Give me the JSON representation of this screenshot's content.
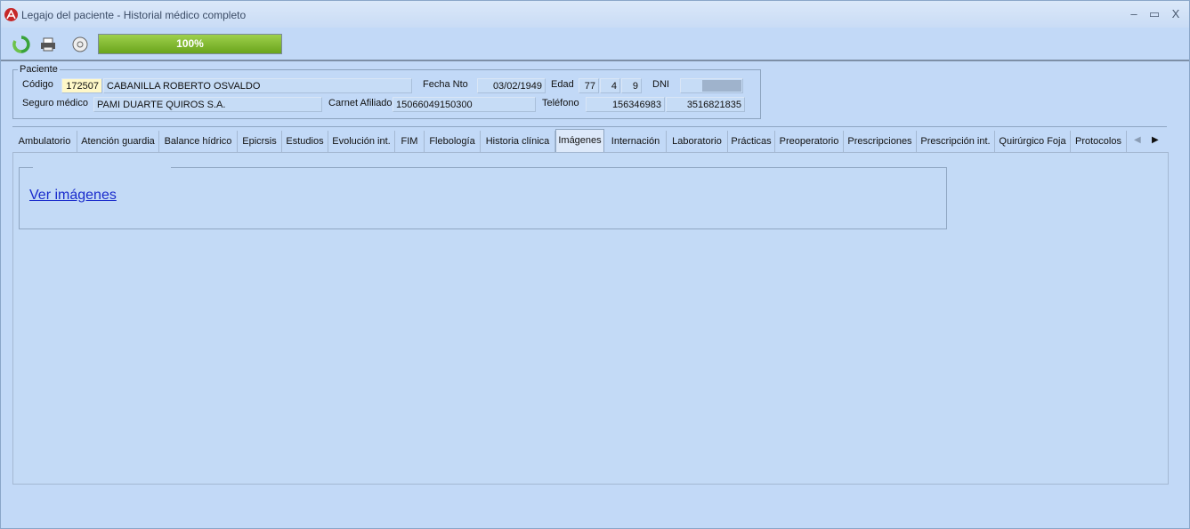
{
  "window": {
    "title": "Legajo del paciente - Historial médico completo",
    "controls": {
      "minimize": "–",
      "maximize": "▭",
      "close": "X"
    }
  },
  "toolbar": {
    "icons": [
      "refresh-icon",
      "printer-icon",
      "options-icon"
    ],
    "progress": {
      "value": 1.0,
      "label": "100%"
    }
  },
  "patient": {
    "legend": "Paciente",
    "codigo_label": "Código",
    "codigo_value": "172507",
    "nombre_value": "CABANILLA ROBERTO OSVALDO",
    "fecha_nto_label": "Fecha Nto",
    "fecha_nto_value": "03/02/1949",
    "edad_label": "Edad",
    "edad_years": "77",
    "edad_months": "4",
    "edad_days": "9",
    "dni_label": "DNI",
    "dni_value": "",
    "seguro_label": "Seguro médico",
    "seguro_value": "PAMI DUARTE QUIROS S.A.",
    "carnet_label": "Carnet Afiliado",
    "carnet_value": "15066049150300",
    "telefono_label": "Teléfono",
    "telefono1": "156346983",
    "telefono2": "3516821835"
  },
  "tabs": [
    "Ambulatorio",
    "Atención guardia",
    "Balance hídrico",
    "Epicrsis",
    "Estudios",
    "Evolución int.",
    "FIM",
    "Flebología",
    "Historia clínica",
    "Imágenes",
    "Internación",
    "Laboratorio",
    "Prácticas",
    "Preoperatorio",
    "Prescripciones",
    "Prescripción int.",
    "Quirúrgico Foja",
    "Protocolos"
  ],
  "active_tab": "Imágenes",
  "content": {
    "link_label": "Ver imágenes"
  }
}
